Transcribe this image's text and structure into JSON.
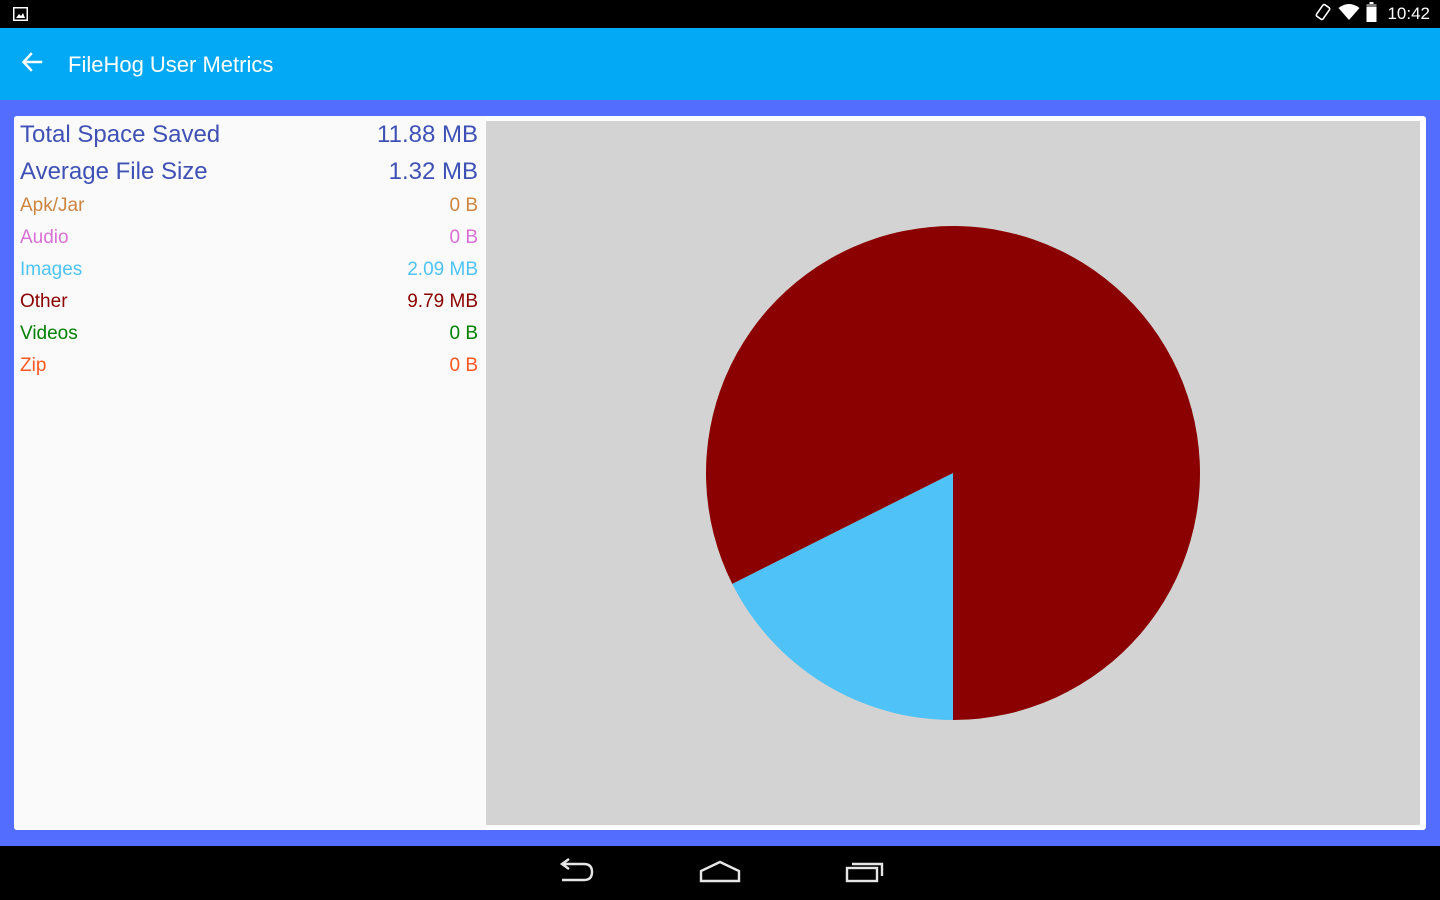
{
  "status_bar": {
    "time": "10:42",
    "icons": [
      "picture-icon",
      "rotate-icon",
      "wifi-icon",
      "battery-icon"
    ]
  },
  "app_bar": {
    "title": "FileHog User Metrics",
    "back_icon": "arrow-left-icon"
  },
  "metrics": {
    "total_space_saved": {
      "label": "Total Space Saved",
      "value": "11.88 MB",
      "color": "#3F51B5"
    },
    "average_file_size": {
      "label": "Average File Size",
      "value": "1.32 MB",
      "color": "#3F51B5"
    },
    "categories": [
      {
        "label": "Apk/Jar",
        "value": "0 B",
        "color": "#CD853F"
      },
      {
        "label": "Audio",
        "value": "0 B",
        "color": "#DA70D6"
      },
      {
        "label": "Images",
        "value": "2.09 MB",
        "color": "#4FC3F7"
      },
      {
        "label": "Other",
        "value": "9.79 MB",
        "color": "#8B0000"
      },
      {
        "label": "Videos",
        "value": "0 B",
        "color": "#008000"
      },
      {
        "label": "Zip",
        "value": "0 B",
        "color": "#FF5722"
      }
    ]
  },
  "chart_data": {
    "type": "pie",
    "categories": [
      "Images",
      "Other"
    ],
    "values": [
      2.09,
      9.79
    ],
    "colors": [
      "#4FC3F7",
      "#8B0000"
    ],
    "background": "#D3D3D3"
  },
  "nav_bar": {
    "icons": [
      "back-nav-icon",
      "home-nav-icon",
      "recents-nav-icon"
    ]
  },
  "colors": {
    "app_bar": "#03A9F4",
    "content_bg": "#536DFE"
  }
}
